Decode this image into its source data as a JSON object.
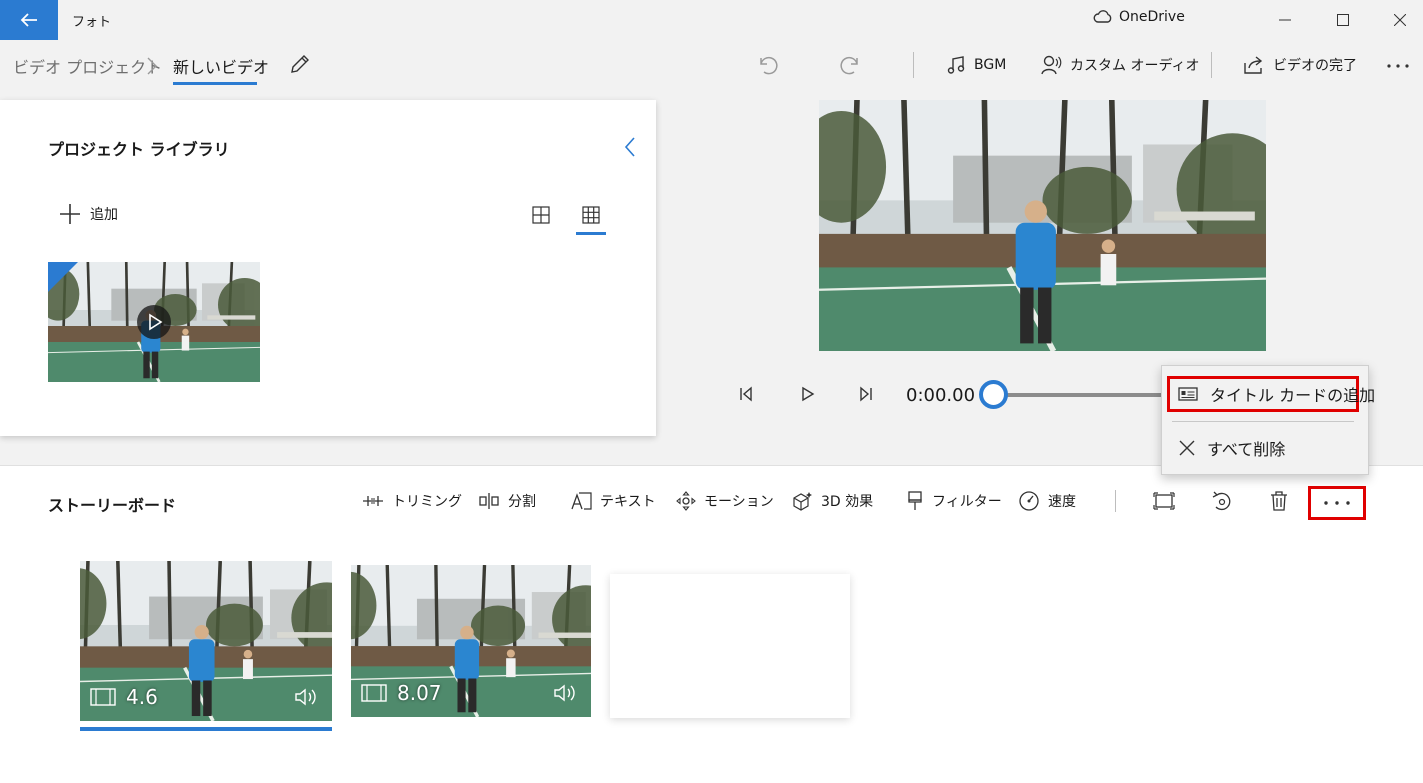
{
  "app": {
    "title": "フォト",
    "cloud_label": "OneDrive"
  },
  "breadcrumb": {
    "root": "ビデオ プロジェクト",
    "current": "新しいビデオ"
  },
  "toolbar": {
    "bgm_label": "BGM",
    "custom_audio_label": "カスタム オーディオ",
    "finish_label": "ビデオの完了",
    "more_label": "..."
  },
  "library": {
    "title": "プロジェクト ライブラリ",
    "add_label": "追加"
  },
  "playback": {
    "time": "0:00.00",
    "position_fraction": 0.0
  },
  "context_menu": {
    "add_title_card": "タイトル カードの追加",
    "delete_all": "すべて削除"
  },
  "storyboard": {
    "title": "ストーリーボード",
    "tools": [
      "トリミング",
      "分割",
      "テキスト",
      "モーション",
      "3D 効果",
      "フィルター",
      "速度"
    ],
    "clips": [
      {
        "duration": "4.6",
        "selected": true
      },
      {
        "duration": "8.07",
        "selected": false
      }
    ]
  },
  "colors": {
    "accent": "#2b7bd1",
    "highlight": "#e00000"
  },
  "icons": [
    "back-arrow-icon",
    "cloud-icon",
    "minimize-icon",
    "maximize-icon",
    "close-icon",
    "chevron-right-icon",
    "pencil-icon",
    "undo-icon",
    "redo-icon",
    "music-note-icon",
    "voice-icon",
    "share-icon",
    "more-icon",
    "chevron-left-icon",
    "plus-icon",
    "grid-large-icon",
    "grid-small-icon",
    "play-icon",
    "previous-frame-icon",
    "next-frame-icon",
    "title-card-icon",
    "close-x-icon",
    "trim-icon",
    "split-icon",
    "text-icon",
    "motion-icon",
    "3d-effects-icon",
    "filter-icon",
    "speed-icon",
    "resize-icon",
    "rotate-icon",
    "trash-icon",
    "film-icon",
    "speaker-icon"
  ]
}
